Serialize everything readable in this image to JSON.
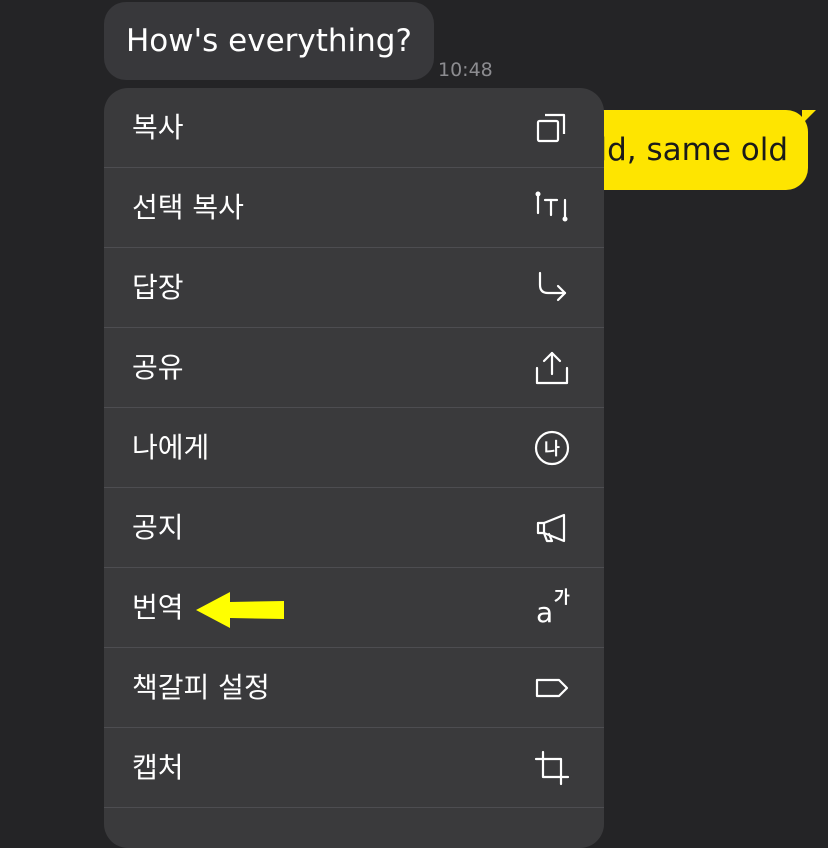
{
  "chat": {
    "incoming_message": "How's everything?",
    "incoming_time": "10:48",
    "outgoing_message": "ld, same old"
  },
  "context_menu": {
    "items": [
      {
        "label": "복사",
        "icon": "copy-icon"
      },
      {
        "label": "선택 복사",
        "icon": "text-select-icon"
      },
      {
        "label": "답장",
        "icon": "reply-arrow-icon"
      },
      {
        "label": "공유",
        "icon": "share-icon"
      },
      {
        "label": "나에게",
        "icon": "to-me-circle-icon",
        "icon_text": "나"
      },
      {
        "label": "공지",
        "icon": "megaphone-icon"
      },
      {
        "label": "번역",
        "icon": "translate-icon",
        "icon_text_a": "a",
        "icon_text_ga": "가"
      },
      {
        "label": "책갈피 설정",
        "icon": "bookmark-tag-icon"
      },
      {
        "label": "캡처",
        "icon": "crop-icon"
      }
    ]
  },
  "annotation": {
    "arrow_color": "#ffff00",
    "points_to": "번역"
  },
  "colors": {
    "background": "#242426",
    "menu": "#3a3a3c",
    "outgoing_bubble": "#fee500",
    "incoming_bubble": "#38383b"
  }
}
